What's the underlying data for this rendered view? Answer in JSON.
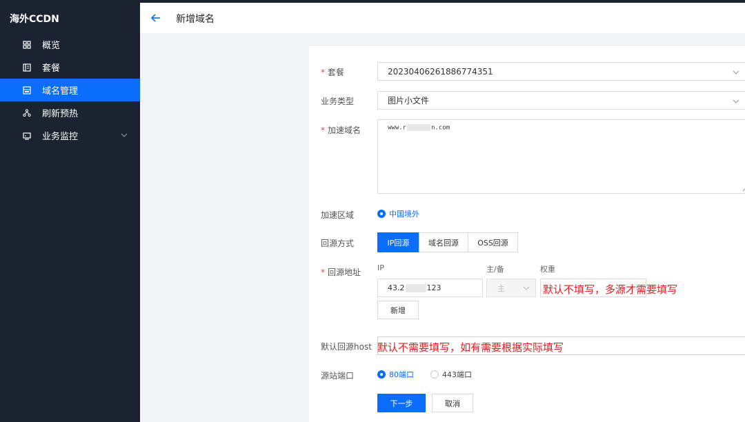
{
  "sidebar": {
    "brand": "海外CCDN",
    "items": [
      {
        "label": "概览",
        "icon": "dashboard-icon"
      },
      {
        "label": "套餐",
        "icon": "package-icon"
      },
      {
        "label": "域名管理",
        "icon": "domain-icon"
      },
      {
        "label": "刷新预热",
        "icon": "refresh-icon"
      },
      {
        "label": "业务监控",
        "icon": "monitor-icon"
      }
    ],
    "active_index": 2
  },
  "header": {
    "title": "新增域名"
  },
  "form": {
    "package": {
      "label": "套餐",
      "value": "20230406261886774351"
    },
    "biz_type": {
      "label": "业务类型",
      "value": "图片小文件"
    },
    "domain": {
      "label": "加速域名",
      "prefix": "www.r",
      "suffix": "n.com"
    },
    "region": {
      "label": "加速区域",
      "option": "中国境外"
    },
    "origin_mode": {
      "label": "回源方式",
      "options": [
        "IP回源",
        "域名回源",
        "OSS回源"
      ],
      "selected": "IP回源"
    },
    "origin_addr": {
      "label": "回源地址",
      "col_ip": "IP",
      "col_role": "主/备",
      "col_weight": "权重",
      "ip_prefix": "43.2",
      "ip_suffix": "123",
      "role_value": "主",
      "add_label": "新增"
    },
    "host": {
      "label": "默认回源host"
    },
    "port": {
      "label": "源站端口",
      "options": [
        "80端口",
        "443端口"
      ],
      "selected": "80端口"
    },
    "next_label": "下一步",
    "cancel_label": "取消"
  },
  "annotations": {
    "weight_note": "默认不填写，多源才需要填写",
    "host_note": "默认不需要填写，如有需要根据实际填写"
  },
  "colors": {
    "sidebar_bg": "#1b2330",
    "accent": "#0b6dfb",
    "annotation_red": "#e02020"
  }
}
